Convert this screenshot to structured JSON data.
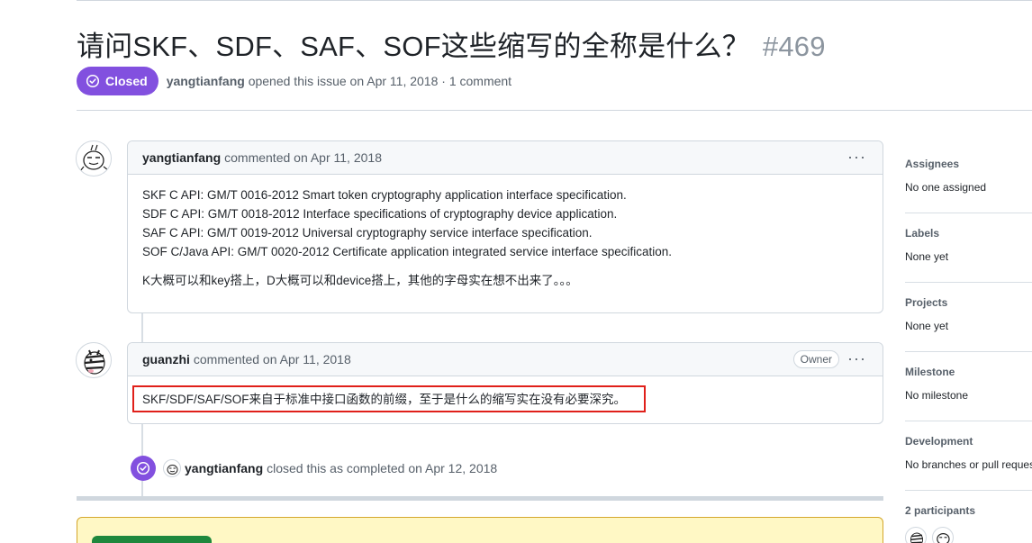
{
  "issue": {
    "title": "请问SKF、SDF、SAF、SOF这些缩写的全称是什么？",
    "number": "#469",
    "status_label": "Closed",
    "author": "yangtianfang",
    "opened_text": "opened this issue on Apr 11, 2018 · 1 comment"
  },
  "comments": [
    {
      "author": "yangtianfang",
      "meta": "commented on Apr 11, 2018",
      "lines": [
        "SKF C API: GM/T 0016-2012 Smart token cryptography application interface specification.",
        "SDF C API: GM/T 0018-2012 Interface specifications of cryptography device application.",
        "SAF C API: GM/T 0019-2012 Universal cryptography service interface specification.",
        "SOF C/Java API: GM/T 0020-2012 Certificate application integrated service interface specification."
      ],
      "note": "K大概可以和key搭上，D大概可以和device搭上，其他的字母实在想不出来了。。。"
    },
    {
      "author": "guanzhi",
      "meta": "commented on Apr 11, 2018",
      "badge": "Owner",
      "body": "SKF/SDF/SAF/SOF来自于标准中接口函数的前缀，至于是什么的缩写实在没有必要深究。"
    }
  ],
  "event": {
    "actor": "yangtianfang",
    "text": "closed this as completed on Apr 12, 2018"
  },
  "menu_glyph": "···",
  "sidebar": {
    "assignees": {
      "title": "Assignees",
      "value": "No one assigned"
    },
    "labels": {
      "title": "Labels",
      "value": "None yet"
    },
    "projects": {
      "title": "Projects",
      "value": "None yet"
    },
    "milestone": {
      "title": "Milestone",
      "value": "No milestone"
    },
    "development": {
      "title": "Development",
      "value": "No branches or pull requests"
    },
    "participants": {
      "title": "2 participants"
    }
  },
  "colors": {
    "closed_purple": "#8250df",
    "highlight_red": "#e0201a",
    "banner_yellow": "#fff8c5",
    "button_green": "#1f883d"
  },
  "icons": [
    "check-circle-icon",
    "rage-face-avatar",
    "zebra-avatar",
    "kebab-menu-icon"
  ]
}
